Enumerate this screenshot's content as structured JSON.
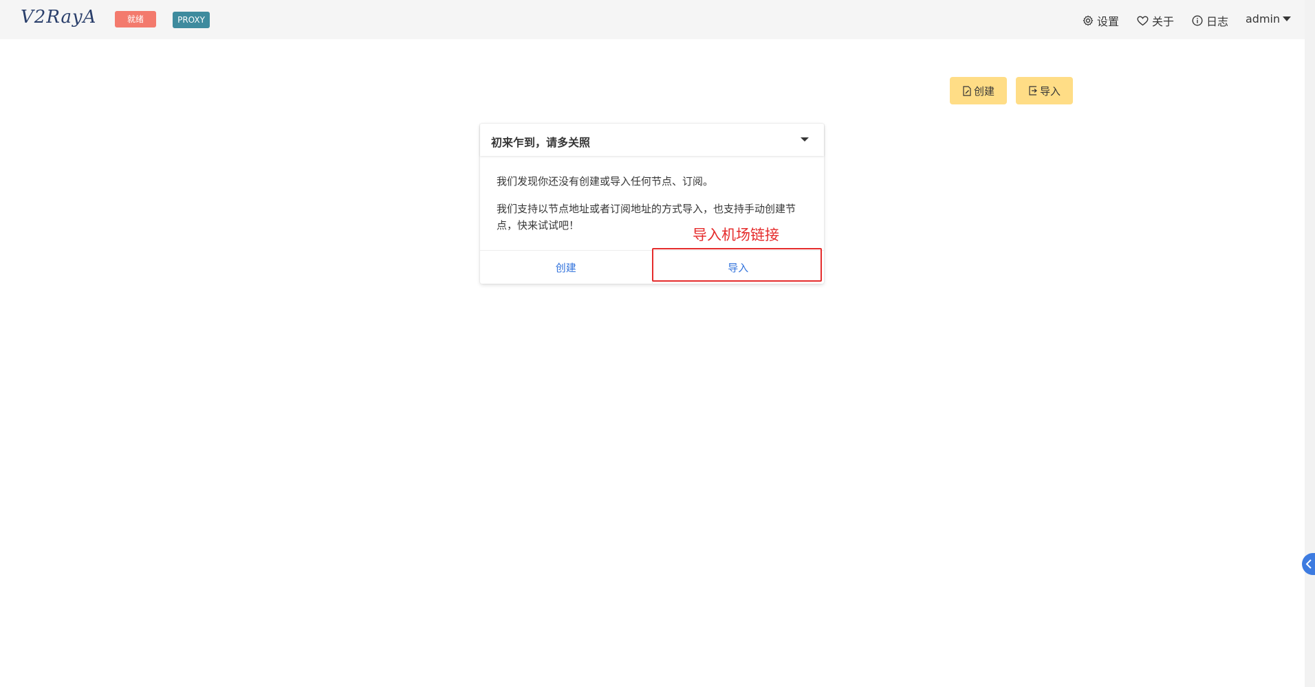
{
  "navbar": {
    "logo_text": "V2RayA",
    "status_tag": "就绪",
    "mode_tag": "PROXY",
    "settings_label": "设置",
    "about_label": "关于",
    "log_label": "日志",
    "user_label": "admin",
    "icons": [
      "gear-icon",
      "heart-icon",
      "info-icon",
      "caret-down-icon"
    ]
  },
  "toolbar": {
    "create_label": "创建",
    "import_label": "导入",
    "button_color": "#ffdd86"
  },
  "card": {
    "title": "初来乍到，请多关照",
    "paragraph1": "我们发现你还没有创建或导入任何节点、订阅。",
    "paragraph2": "我们支持以节点地址或者订阅地址的方式导入，也支持手动创建节点，快来试试吧！",
    "footer_create": "创建",
    "footer_import": "导入"
  },
  "annotation": {
    "text": "导入机场链接",
    "color": "#e52b2b"
  },
  "colors": {
    "ready_tag": "#f37a6d",
    "proxy_tag": "#3e8b9e",
    "link": "#3273dc",
    "side_tab": "#3d7be0"
  }
}
